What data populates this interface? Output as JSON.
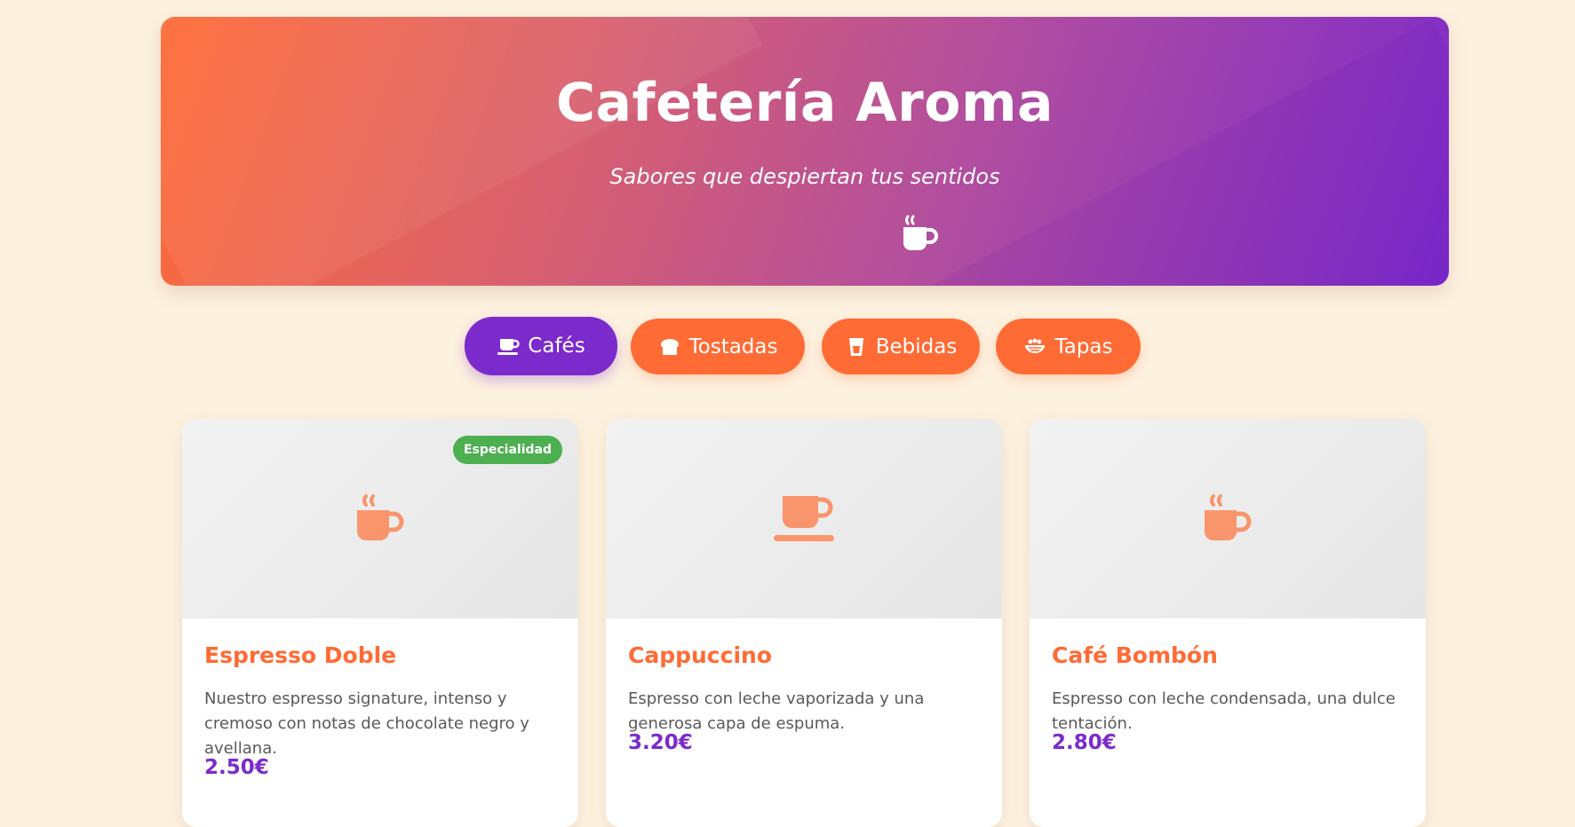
{
  "header": {
    "title": "Cafetería Aroma",
    "subtitle": "Sabores que despiertan tus sentidos",
    "icon": "hot-coffee-icon"
  },
  "tabs": [
    {
      "label": "Cafés",
      "icon": "coffee-cup-saucer-icon",
      "active": true
    },
    {
      "label": "Tostadas",
      "icon": "bread-icon",
      "active": false
    },
    {
      "label": "Bebidas",
      "icon": "glass-icon",
      "active": false
    },
    {
      "label": "Tapas",
      "icon": "bowl-food-icon",
      "active": false
    }
  ],
  "products": [
    {
      "name": "Espresso Doble",
      "description": "Nuestro espresso signature, intenso y cremoso con notas de chocolate negro y avellana.",
      "price": "2.50€",
      "badge": "Especialidad",
      "icon": "hot-coffee-icon"
    },
    {
      "name": "Cappuccino",
      "description": "Espresso con leche vaporizada y una generosa capa de espuma.",
      "price": "3.20€",
      "icon": "coffee-cup-saucer-icon"
    },
    {
      "name": "Café Bombón",
      "description": "Espresso con leche condensada, una dulce tentación.",
      "price": "2.80€",
      "icon": "hot-coffee-icon"
    }
  ],
  "colors": {
    "background": "#fdf1df",
    "primary_orange": "#ff6b35",
    "primary_purple": "#7b2acb",
    "badge_green": "#4caf50",
    "icon_peach": "#f9956c"
  }
}
